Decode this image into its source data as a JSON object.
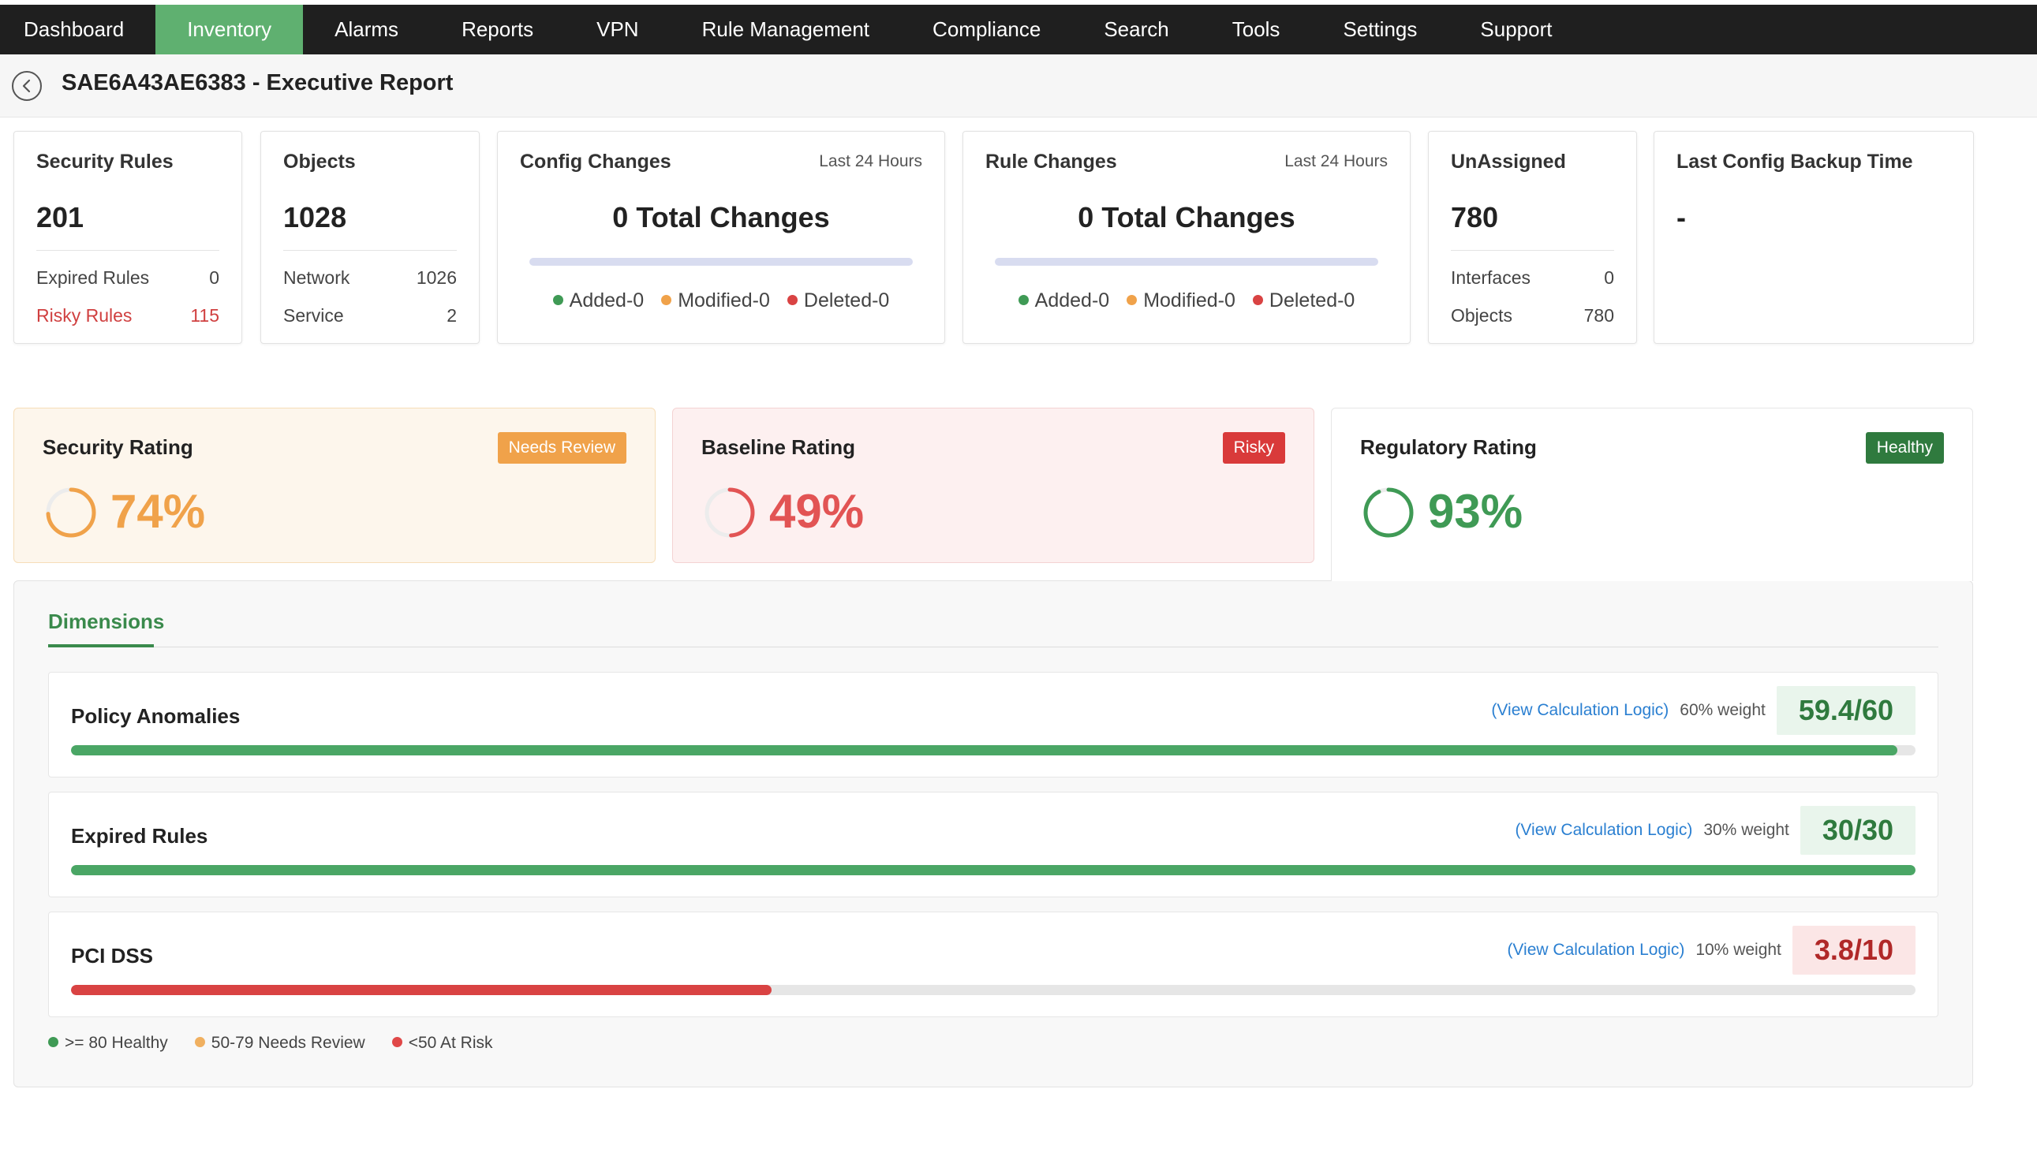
{
  "nav": {
    "items": [
      "Dashboard",
      "Inventory",
      "Alarms",
      "Reports",
      "VPN",
      "Rule Management",
      "Compliance",
      "Search",
      "Tools",
      "Settings",
      "Support"
    ],
    "active": "Inventory"
  },
  "header": {
    "title": "SAE6A43AE6383 - Executive Report",
    "back_icon": "back-arrow-circle-icon"
  },
  "cards": {
    "security_rules": {
      "title": "Security Rules",
      "value": "201",
      "rows": [
        {
          "label": "Expired Rules",
          "value": "0"
        },
        {
          "label": "Risky Rules",
          "value": "115"
        }
      ]
    },
    "objects": {
      "title": "Objects",
      "value": "1028",
      "rows": [
        {
          "label": "Network",
          "value": "1026"
        },
        {
          "label": "Service",
          "value": "2"
        }
      ]
    },
    "config_changes": {
      "title": "Config Changes",
      "subtitle": "Last 24 Hours",
      "total": "0 Total Changes",
      "added": "Added-0",
      "modified": "Modified-0",
      "deleted": "Deleted-0"
    },
    "rule_changes": {
      "title": "Rule Changes",
      "subtitle": "Last 24 Hours",
      "total": "0 Total Changes",
      "added": "Added-0",
      "modified": "Modified-0",
      "deleted": "Deleted-0"
    },
    "unassigned": {
      "title": "UnAssigned",
      "value": "780",
      "rows": [
        {
          "label": "Interfaces",
          "value": "0"
        },
        {
          "label": "Objects",
          "value": "780"
        }
      ]
    },
    "backup": {
      "title": "Last Config Backup Time",
      "value": "-"
    }
  },
  "ratings": {
    "security": {
      "title": "Security Rating",
      "badge": "Needs Review",
      "value": "74%",
      "percent": 74,
      "color": "#f0a24a",
      "badge_color": "#f0a24a",
      "bg": "#fdf6ec",
      "border": "#f6ddb8"
    },
    "baseline": {
      "title": "Baseline Rating",
      "badge": "Risky",
      "value": "49%",
      "percent": 49,
      "color": "#e25454",
      "badge_color": "#d93a3a",
      "bg": "#fdf0f0",
      "border": "#f4d3d3"
    },
    "regulatory": {
      "title": "Regulatory Rating",
      "badge": "Healthy",
      "value": "93%",
      "percent": 93,
      "color": "#3f9a55",
      "badge_color": "#2f7a3e",
      "bg": "#ffffff",
      "border": "#e6e6e6"
    }
  },
  "dimensions": {
    "tab": "Dimensions",
    "rows": [
      {
        "name": "Policy Anomalies",
        "link": "(View Calculation Logic)",
        "weight": "60% weight",
        "score": "59.4/60",
        "fraction": 0.99,
        "bar_color": "#4aa665",
        "score_bg": "#e9f5ec",
        "score_color": "#2f7a3e"
      },
      {
        "name": "Expired Rules",
        "link": "(View Calculation Logic)",
        "weight": "30% weight",
        "score": "30/30",
        "fraction": 1.0,
        "bar_color": "#4aa665",
        "score_bg": "#e9f5ec",
        "score_color": "#2f7a3e"
      },
      {
        "name": "PCI DSS",
        "link": "(View Calculation Logic)",
        "weight": "10% weight",
        "score": "3.8/10",
        "fraction": 0.38,
        "bar_color": "#d94343",
        "score_bg": "#fbe6e6",
        "score_color": "#b02828"
      }
    ],
    "legend": [
      {
        "label": ">= 80 Healthy",
        "color": "#3f9a55"
      },
      {
        "label": "50-79 Needs Review",
        "color": "#f0b060"
      },
      {
        "label": "<50 At Risk",
        "color": "#e04848"
      }
    ]
  },
  "colors": {
    "added": "#3f9a55",
    "modified": "#f0a24a",
    "deleted": "#d94343"
  }
}
